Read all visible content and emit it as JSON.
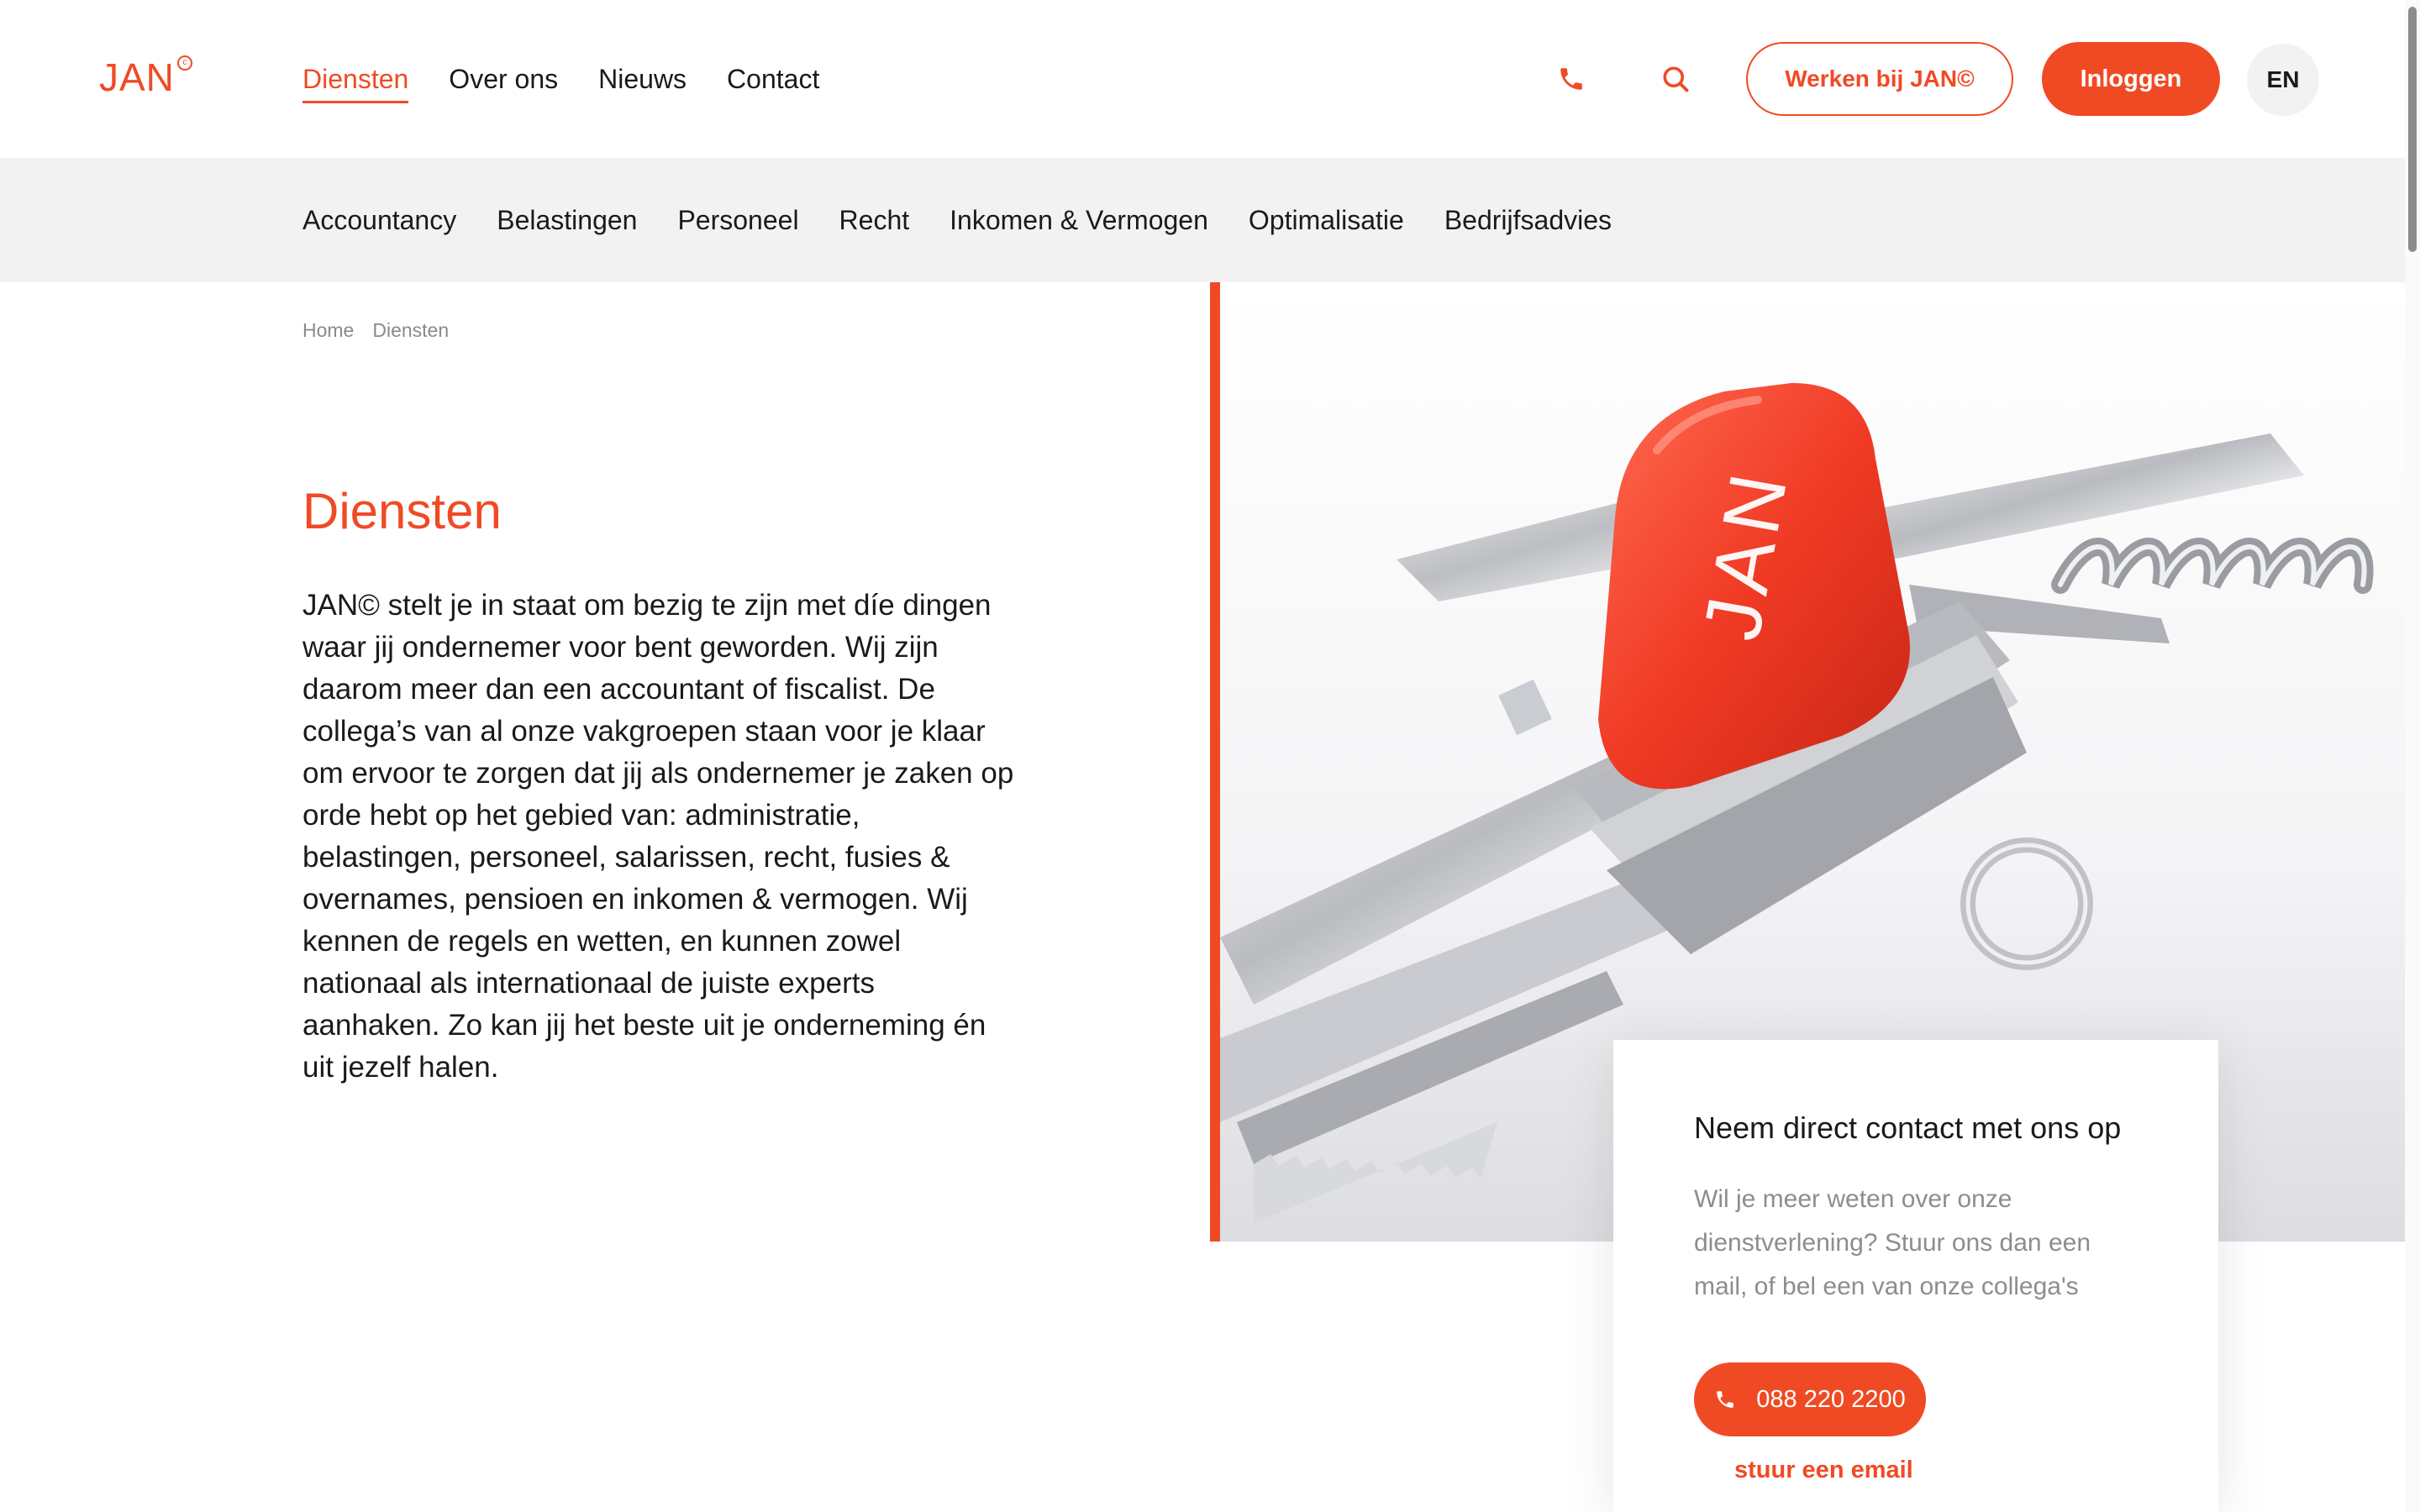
{
  "brand": {
    "logo_text": "JAN",
    "logo_mark": "c",
    "accent": "#f04a24"
  },
  "header": {
    "nav": [
      "Diensten",
      "Over ons",
      "Nieuws",
      "Contact"
    ],
    "active_nav": "Diensten",
    "icons": [
      "phone-icon",
      "search-icon"
    ],
    "careers_button": "Werken bij JAN©",
    "login_button": "Inloggen",
    "language": "EN"
  },
  "subnav": [
    "Accountancy",
    "Belastingen",
    "Personeel",
    "Recht",
    "Inkomen & Vermogen",
    "Optimalisatie",
    "Bedrijfsadvies"
  ],
  "breadcrumb": [
    "Home",
    "Diensten"
  ],
  "main": {
    "title": "Diensten",
    "intro": "JAN© stelt je in staat om bezig te zijn met díe dingen waar jij ondernemer voor bent geworden. Wij zijn daarom meer dan een accountant of fiscalist. De collega’s van al onze vakgroepen staan voor je klaar om ervoor te zorgen dat jij als ondernemer je zaken op orde hebt op het gebied van: administratie, belastingen, personeel, salarissen, recht, fusies & overnames, pensioen en inkomen & vermogen. Wij kennen de regels en wetten, en kunnen zowel nationaal als internationaal de juiste experts aanhaken. Zo kan jij het beste uit je onderneming én uit jezelf halen."
  },
  "contact": {
    "title": "Neem direct contact met ons op",
    "body": "Wil je meer weten over onze dienstverlening? Stuur ons dan een mail, of bel een van onze collega's",
    "phone": "088 220 2200",
    "email_link": "stuur een email"
  }
}
